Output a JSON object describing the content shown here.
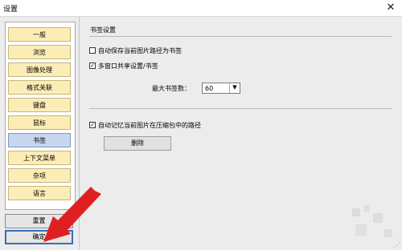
{
  "window": {
    "title": "设置",
    "close_glyph": "✕"
  },
  "sidebar": {
    "items": [
      {
        "label": "一般",
        "selected": false
      },
      {
        "label": "浏览",
        "selected": false
      },
      {
        "label": "图像处理",
        "selected": false
      },
      {
        "label": "格式关联",
        "selected": false
      },
      {
        "label": "键盘",
        "selected": false
      },
      {
        "label": "鼠标",
        "selected": false
      },
      {
        "label": "书签",
        "selected": true
      },
      {
        "label": "上下文菜单",
        "selected": false
      },
      {
        "label": "杂项",
        "selected": false
      },
      {
        "label": "语言",
        "selected": false
      }
    ],
    "reset_label": "重置",
    "ok_label": "确定"
  },
  "bookmark": {
    "section_title": "书签设置",
    "auto_save": {
      "label": "自动保存当前图片路径为书签",
      "checked": false
    },
    "multi_window": {
      "label": "多窗口共享设置/书签",
      "checked": true
    },
    "max_label": "最大书签数：",
    "max_value": "60",
    "remember_archive": {
      "label": "自动记忆当前图片在压缩包中的路径",
      "checked": true
    },
    "delete_label": "删除"
  },
  "colors": {
    "nav_item": "#fcedb6",
    "nav_selected": "#c6d7ef",
    "arrow": "#e02020",
    "ok_border": "#3a6db6"
  },
  "icons": {
    "check": "✓",
    "dropdown": "chevron-down-icon",
    "grip": "⋰"
  }
}
